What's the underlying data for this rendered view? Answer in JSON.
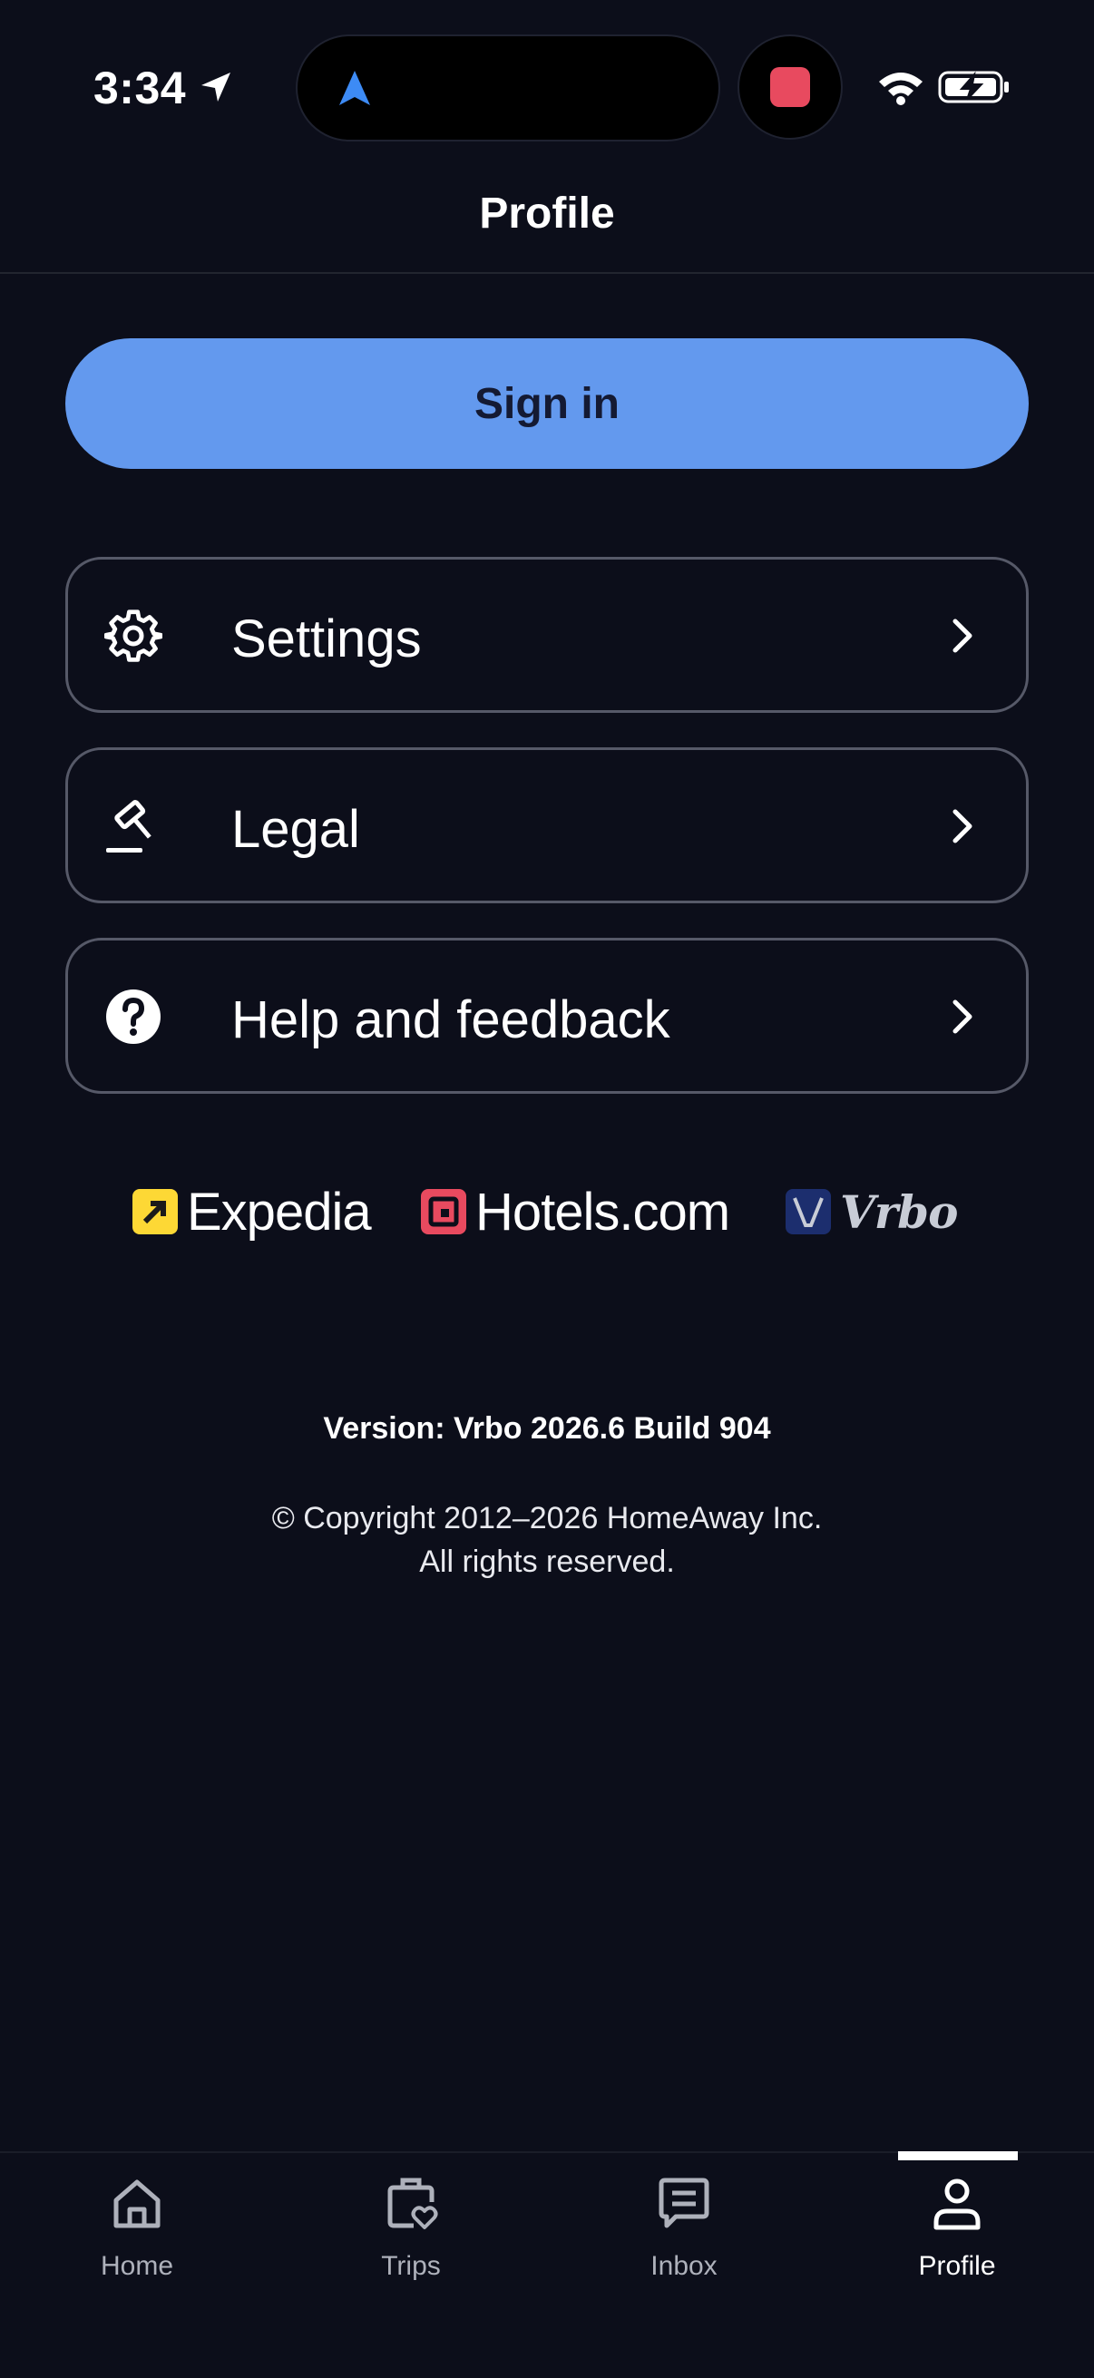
{
  "status_bar": {
    "time": "3:34"
  },
  "header": {
    "title": "Profile"
  },
  "sign_in": {
    "label": "Sign in"
  },
  "menu": [
    {
      "label": "Settings",
      "icon": "gear-icon"
    },
    {
      "label": "Legal",
      "icon": "gavel-icon"
    },
    {
      "label": "Help and feedback",
      "icon": "question-circle-icon"
    }
  ],
  "brands": [
    {
      "name": "Expedia",
      "color": "#fdd835"
    },
    {
      "name": "Hotels.com",
      "color": "#e84a5f"
    },
    {
      "name": "Vrbo",
      "color": "#1c2e6e"
    }
  ],
  "version": "Version: Vrbo 2026.6 Build 904",
  "copyright": {
    "line1": "© Copyright 2012–2026 HomeAway Inc.",
    "line2": "All rights reserved."
  },
  "bottom_nav": {
    "items": [
      {
        "label": "Home",
        "icon": "home-icon"
      },
      {
        "label": "Trips",
        "icon": "trips-icon"
      },
      {
        "label": "Inbox",
        "icon": "inbox-icon"
      },
      {
        "label": "Profile",
        "icon": "profile-icon"
      }
    ],
    "active": "Profile"
  },
  "colors": {
    "background": "#0c0e1a",
    "accent": "#6399ee",
    "border": "#565968"
  }
}
